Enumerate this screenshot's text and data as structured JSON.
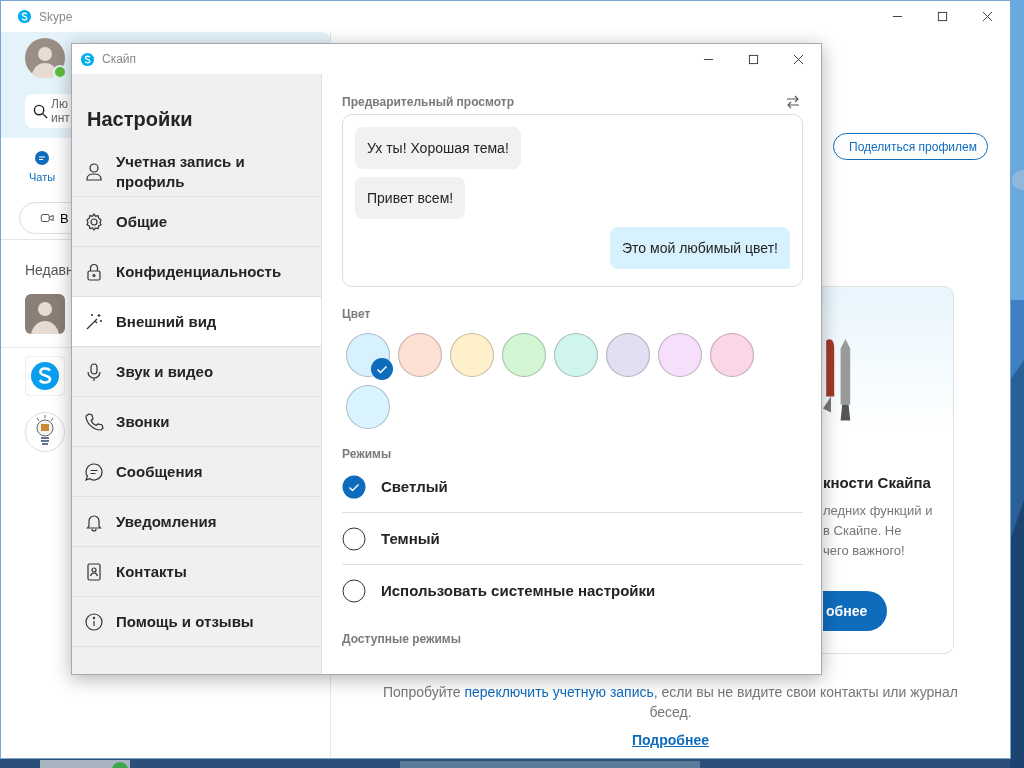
{
  "main_window": {
    "title": "Skype",
    "search": {
      "lines": [
        "Лю",
        "инт"
      ]
    },
    "tabs": [
      {
        "label": "Чаты",
        "selected": true
      }
    ],
    "call_button": "В",
    "section_title": "Недавн",
    "chats": [
      {
        "kind": "person"
      },
      {
        "kind": "skype"
      },
      {
        "kind": "bulb"
      }
    ],
    "share_button": "Поделиться профилем",
    "card": {
      "title": "кности Скайпа",
      "lines": [
        "ледних функций и",
        "в Скайпе. Не",
        "чего важного!"
      ],
      "button": "обнее"
    },
    "footer": {
      "before": "Попробуйте ",
      "link": "переключить учетную запись",
      "after": ", если вы не видите свои контакты или журнал бесед.",
      "more": "Подробнее"
    }
  },
  "settings": {
    "title": "Скайп",
    "heading": "Настройки",
    "nav": [
      {
        "label": "Учетная запись и профиль",
        "selected": false
      },
      {
        "label": "Общие",
        "selected": false
      },
      {
        "label": "Конфиденциальность",
        "selected": false
      },
      {
        "label": "Внешний вид",
        "selected": true
      },
      {
        "label": "Звук и видео",
        "selected": false
      },
      {
        "label": "Звонки",
        "selected": false
      },
      {
        "label": "Сообщения",
        "selected": false
      },
      {
        "label": "Уведомления",
        "selected": false
      },
      {
        "label": "Контакты",
        "selected": false
      },
      {
        "label": "Помощь и отзывы",
        "selected": false
      }
    ],
    "preview": {
      "title": "Предварительный просмотр",
      "messages": [
        {
          "text": "Ух ты! Хорошая тема!",
          "outgoing": false
        },
        {
          "text": "Привет всем!",
          "outgoing": false
        },
        {
          "text": "Это мой любимый цвет!",
          "outgoing": true
        }
      ]
    },
    "colors": {
      "title": "Цвет",
      "swatches": [
        {
          "color": "#d7f2fe",
          "selected": true
        },
        {
          "color": "#fde0d4",
          "selected": false
        },
        {
          "color": "#fff0cc",
          "selected": false
        },
        {
          "color": "#d3f5d3",
          "selected": false
        },
        {
          "color": "#cff5ec",
          "selected": false
        },
        {
          "color": "#e1dff2",
          "selected": false
        },
        {
          "color": "#f5dffa",
          "selected": false
        },
        {
          "color": "#fad6e6",
          "selected": false
        },
        {
          "color": "#d9f4fe",
          "selected": false
        }
      ]
    },
    "modes": {
      "title": "Режимы",
      "options": [
        {
          "label": "Светлый",
          "selected": true
        },
        {
          "label": "Темный",
          "selected": false
        },
        {
          "label": "Использовать системные настройки",
          "selected": false
        }
      ]
    },
    "available_title": "Доступные режимы"
  }
}
